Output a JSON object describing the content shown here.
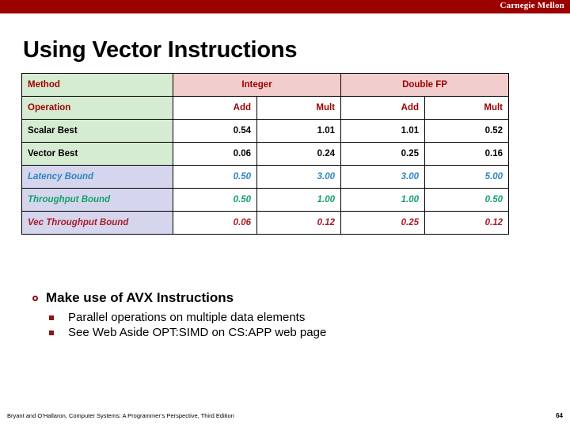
{
  "banner": {
    "brand": "Carnegie Mellon",
    "color": "#9C0000"
  },
  "slide": {
    "title": "Using Vector Instructions",
    "page_number": "64",
    "footer": "Bryant and O’Hallaron, Computer Systems: A Programmer’s Perspective, Third Edition"
  },
  "table": {
    "group_header": {
      "label": "Method",
      "groups": [
        "Integer",
        "Double FP"
      ]
    },
    "operation_row": {
      "label": "Operation",
      "values": [
        "Add",
        "Mult",
        "Add",
        "Mult"
      ]
    },
    "rows": [
      {
        "label": "Scalar Best",
        "style": "black",
        "label_bg": "green",
        "values": [
          "0.54",
          "1.01",
          "1.01",
          "0.52"
        ]
      },
      {
        "label": "Vector Best",
        "style": "black",
        "label_bg": "green",
        "values": [
          "0.06",
          "0.24",
          "0.25",
          "0.16"
        ]
      },
      {
        "label": "Latency Bound",
        "style": "blue",
        "label_bg": "lav",
        "values": [
          "0.50",
          "3.00",
          "3.00",
          "5.00"
        ]
      },
      {
        "label": "Throughput Bound",
        "style": "green",
        "label_bg": "lav",
        "values": [
          "0.50",
          "1.00",
          "1.00",
          "0.50"
        ]
      },
      {
        "label": "Vec Throughput Bound",
        "style": "red",
        "label_bg": "lav",
        "values": [
          "0.06",
          "0.12",
          "0.25",
          "0.12"
        ]
      }
    ],
    "colors": {
      "label_green": "#D6ECD2",
      "label_lavender": "#D5D5EE",
      "group_pink": "#F2CDCD",
      "header_text": "#9C0000",
      "blue": "#2E86C1",
      "green": "#17A06A",
      "red": "#A81D2B"
    }
  },
  "bullets": {
    "main": "Make use of AVX Instructions",
    "subs": [
      "Parallel operations on multiple data elements",
      "See Web Aside OPT:SIMD on CS:APP web page"
    ]
  }
}
